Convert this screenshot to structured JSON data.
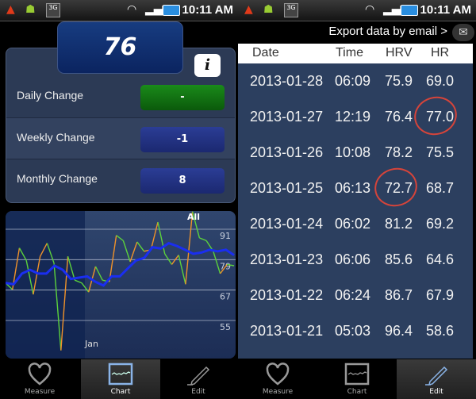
{
  "status_bar": {
    "time": "10:11 AM",
    "icons": [
      "warning-icon",
      "android-icon",
      "3g-icon",
      "wifi-icon",
      "signal-icon",
      "battery-icon"
    ]
  },
  "summary": {
    "current_hrv": "76",
    "info_label": "i",
    "changes": [
      {
        "label": "Daily Change",
        "value": "-",
        "color": "#137a13"
      },
      {
        "label": "Weekly Change",
        "value": "-1",
        "color": "#23338a"
      },
      {
        "label": "Monthly Change",
        "value": "8",
        "color": "#23338a"
      }
    ]
  },
  "chart_data": {
    "type": "line",
    "range_label": "All",
    "x_tick_labels": [
      "Jan"
    ],
    "yticks": [
      55,
      67,
      79,
      91
    ],
    "grid": true,
    "series": [
      {
        "color": "#5cd23c",
        "alt_color": "#f0922a",
        "values": [
          69.8,
          67.2,
          83.6,
          78.7,
          65.3,
          80.3,
          85.5,
          77.6,
          43.2,
          80.3,
          70.9,
          69.8,
          66.2,
          76.3,
          70.9,
          70.3,
          88.6,
          86.5,
          78.2,
          86.0,
          82.3,
          82.9,
          93.8,
          81.3,
          77.1,
          80.8,
          69.3,
          98.0,
          87.6,
          86.5,
          82.3,
          73.5,
          77.1,
          76.6
        ]
      },
      {
        "color": "#1a2ef0",
        "values": [
          69.8,
          69.3,
          73.5,
          75.0,
          73.5,
          73.5,
          76.6,
          75.0,
          71.4,
          71.9,
          72.4,
          70.3,
          68.8,
          72.4,
          72.4,
          75.6,
          78.7,
          79.7,
          83.9,
          83.4,
          85.5,
          84.4,
          82.9,
          81.3,
          81.8,
          82.9,
          82.3,
          82.9,
          80.8
        ]
      }
    ]
  },
  "nav": {
    "tabs": [
      {
        "label": "Measure",
        "icon": "heart-icon"
      },
      {
        "label": "Chart",
        "icon": "chart-icon"
      },
      {
        "label": "Edit",
        "icon": "pencil-icon"
      }
    ]
  },
  "history": {
    "export_label": "Export data by email >",
    "columns": [
      "Date",
      "Time",
      "HRV",
      "HR"
    ],
    "rows": [
      [
        "2013-01-28",
        "06:09",
        "75.9",
        "69.0"
      ],
      [
        "2013-01-27",
        "12:19",
        "76.4",
        "77.0"
      ],
      [
        "2013-01-26",
        "10:08",
        "78.2",
        "75.5"
      ],
      [
        "2013-01-25",
        "06:13",
        "72.7",
        "68.7"
      ],
      [
        "2013-01-24",
        "06:02",
        "81.2",
        "69.2"
      ],
      [
        "2013-01-23",
        "06:06",
        "85.6",
        "64.6"
      ],
      [
        "2013-01-22",
        "06:24",
        "86.7",
        "67.9"
      ],
      [
        "2013-01-21",
        "05:03",
        "96.4",
        "58.6"
      ]
    ],
    "annotations": "red circles around 77.0 and 72.7"
  }
}
